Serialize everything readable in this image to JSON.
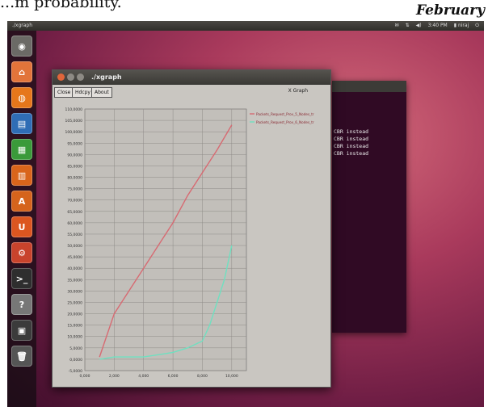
{
  "document": {
    "fragment_text": "...m probability.",
    "header_word": "February"
  },
  "desktop": {
    "panel_title": "./xgraph",
    "indicators": [
      "✉",
      "⇅",
      "◀)",
      "3:40 PM",
      "▮ niraj",
      "⏻"
    ],
    "launcher_items": [
      {
        "icon": "dash-icon",
        "glyph": "◉",
        "color": "#6b6a66"
      },
      {
        "icon": "home-folder-icon",
        "glyph": "⌂",
        "color": "#e2743a"
      },
      {
        "icon": "firefox-icon",
        "glyph": "◍",
        "color": "#e6771b"
      },
      {
        "icon": "writer-icon",
        "glyph": "▤",
        "color": "#2f6db5"
      },
      {
        "icon": "calc-icon",
        "glyph": "▦",
        "color": "#3a9a3a"
      },
      {
        "icon": "impress-icon",
        "glyph": "▥",
        "color": "#d9651b"
      },
      {
        "icon": "software-center-icon",
        "glyph": "A",
        "color": "#d5641c"
      },
      {
        "icon": "ubuntu-one-icon",
        "glyph": "U",
        "color": "#dc5620"
      },
      {
        "icon": "system-settings-icon",
        "glyph": "⚙",
        "color": "#c8432c"
      },
      {
        "icon": "terminal-icon",
        "glyph": ">_",
        "color": "#2e2e2e"
      },
      {
        "icon": "help-icon",
        "glyph": "?",
        "color": "#777777"
      },
      {
        "icon": "workspace-icon",
        "glyph": "▣",
        "color": "#3b3b3b"
      },
      {
        "icon": "trash-icon",
        "glyph": "🗑",
        "color": "#555555"
      }
    ]
  },
  "terminal": {
    "lines": [
      "",
      "",
      "",
      "",
      "",
      "CBR instead",
      "CBR instead",
      "CBR instead",
      "CBR instead"
    ]
  },
  "xgraph": {
    "title": "./xgraph",
    "buttons": [
      "Close",
      "Hdcpy",
      "About"
    ],
    "graph_label": "X Graph",
    "chart_data": {
      "type": "line",
      "x_ticks": [
        "0,000",
        "2,000",
        "4,000",
        "6,000",
        "8,000",
        "10,000"
      ],
      "y_ticks": [
        "-5,0000",
        "0,0000",
        "5,0000",
        "10,0000",
        "15,0000",
        "20,0000",
        "25,0000",
        "30,0000",
        "35,0000",
        "40,0000",
        "45,0000",
        "50,0000",
        "55,0000",
        "60,0000",
        "65,0000",
        "70,0000",
        "75,0000",
        "80,0000",
        "85,0000",
        "90,0000",
        "95,0000",
        "100,0000",
        "105,0000",
        "110,0000"
      ],
      "xlim": [
        0,
        11000
      ],
      "ylim": [
        -5,
        110
      ],
      "grid": true,
      "legend_position": "top-right",
      "series": [
        {
          "name": "Packets_Request_Prov_5_Nodes_tr",
          "color": "#d76a72",
          "x": [
            1000,
            2000,
            3000,
            4000,
            5000,
            6000,
            7000,
            8000,
            9000,
            10000
          ],
          "y": [
            1,
            20,
            30,
            40,
            50,
            60,
            72,
            82,
            92,
            103
          ]
        },
        {
          "name": "Packets_Request_Prov_6_Nodes_tr",
          "color": "#6fe0c0",
          "x": [
            1000,
            2000,
            3000,
            4000,
            5000,
            6000,
            7000,
            8000,
            8500,
            9000,
            9500,
            10000
          ],
          "y": [
            0,
            1,
            1,
            1,
            2,
            3,
            5,
            8,
            15,
            25,
            35,
            50
          ]
        }
      ]
    }
  }
}
